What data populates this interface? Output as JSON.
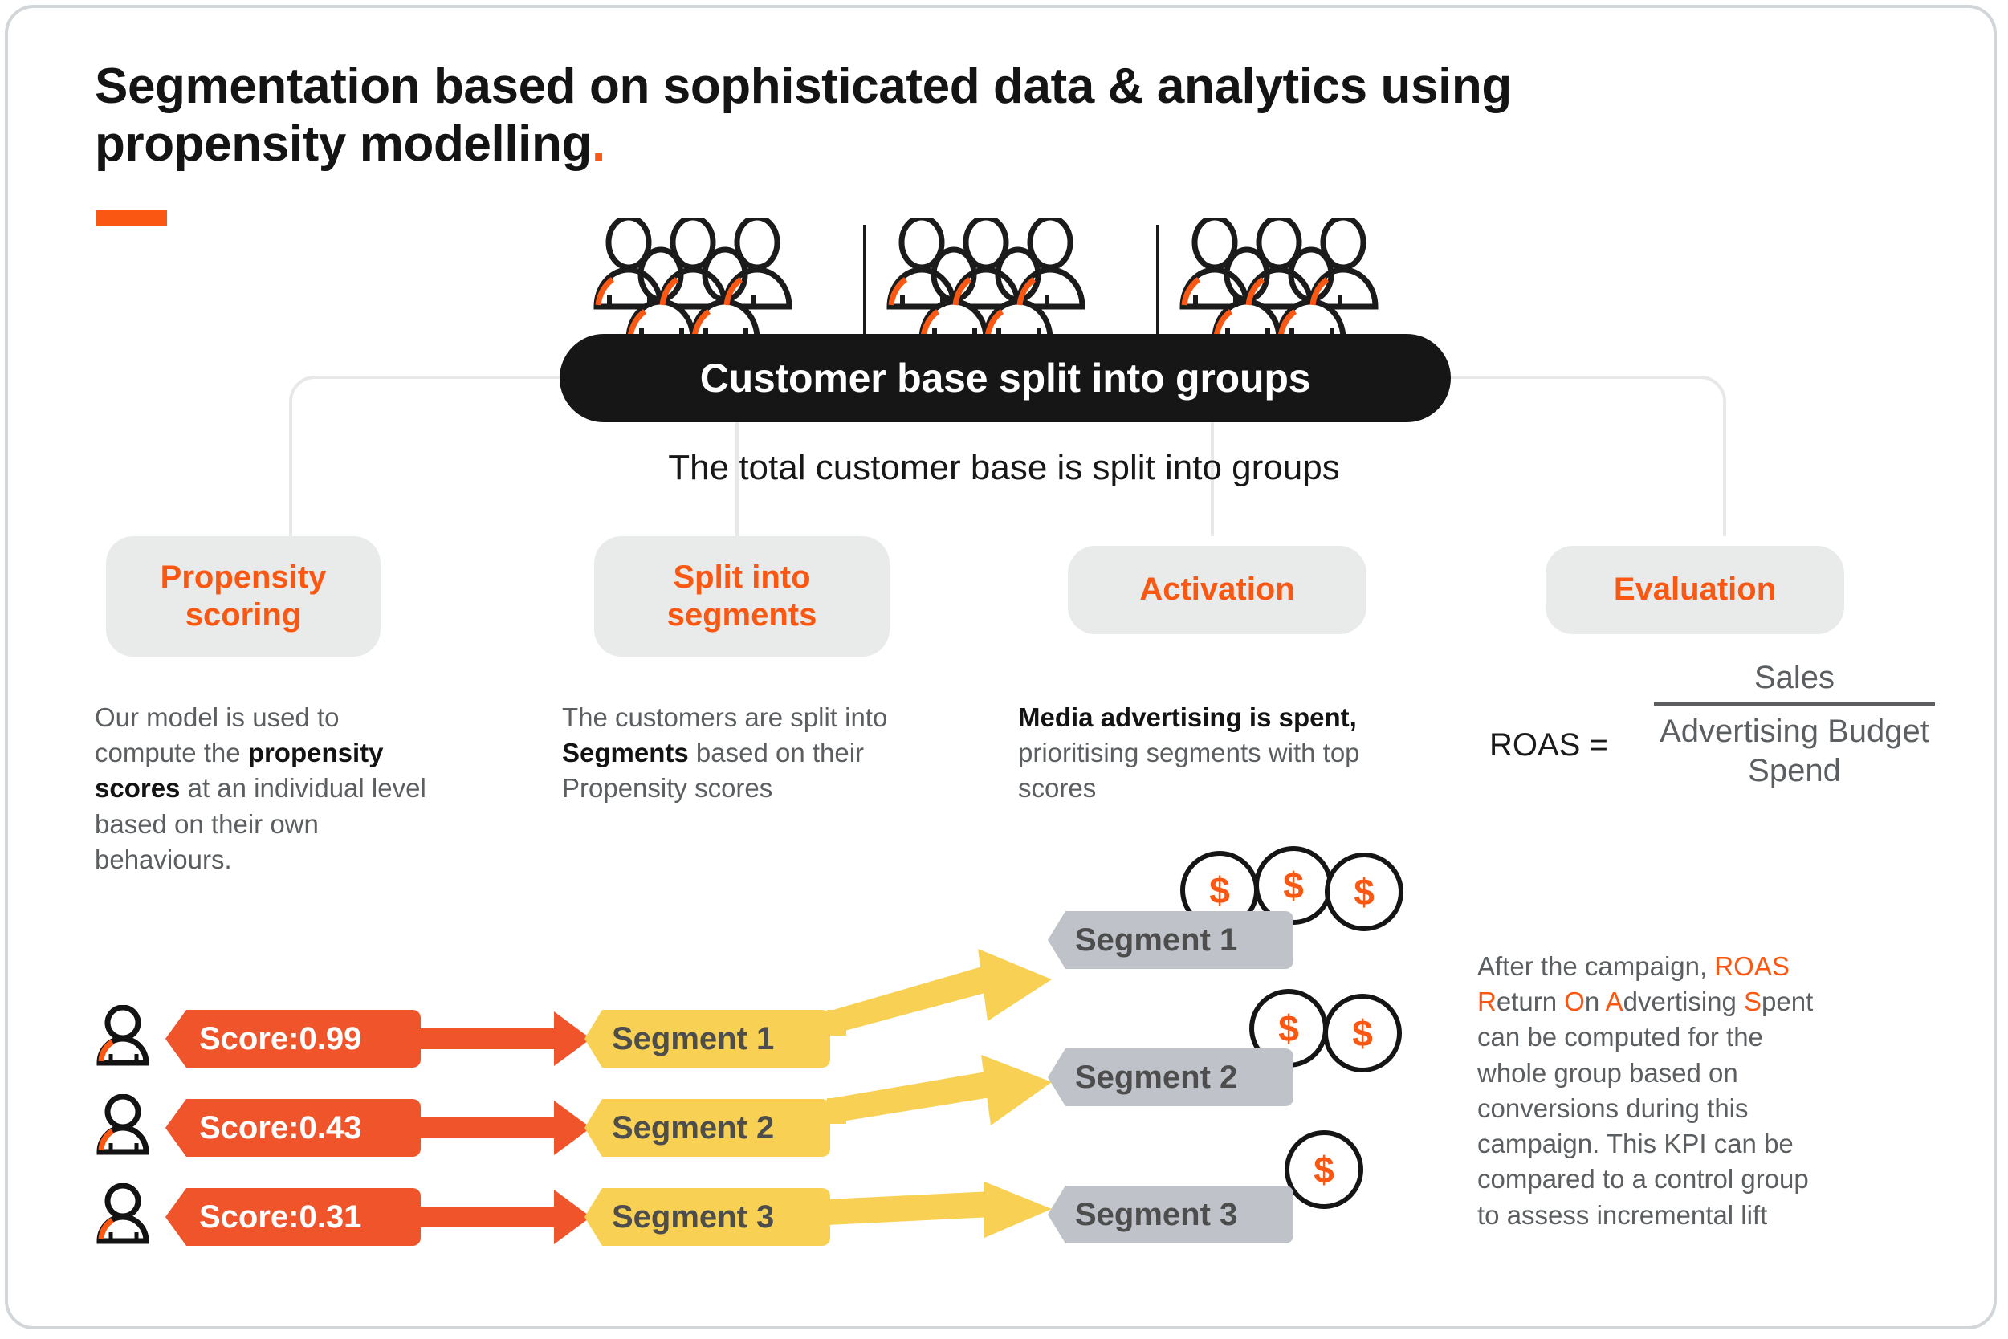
{
  "title": {
    "line1": "Segmentation based on sophisticated data & analytics using",
    "line2": "propensity modelling",
    "period": "."
  },
  "hero": {
    "pill_label": "Customer base split into groups",
    "subtitle": "The total customer base is split into groups",
    "group_count": 3,
    "people_per_group": 6
  },
  "stages": [
    {
      "label": "Propensity scoring",
      "label_line1": "Propensity",
      "label_line2": "scoring"
    },
    {
      "label": "Split into segments",
      "label_line1": "Split into",
      "label_line2": "segments"
    },
    {
      "label": "Activation",
      "label_line1": "Activation",
      "label_line2": ""
    },
    {
      "label": "Evaluation",
      "label_line1": "Evaluation",
      "label_line2": ""
    }
  ],
  "columns": {
    "propensity": {
      "text_a": "Our model is used to compute the ",
      "text_bold": "propensity scores",
      "text_b": " at an individual level based on their own behaviours."
    },
    "split": {
      "text_a": "The customers are split into ",
      "text_bold": "Segments",
      "text_b": " based on their Propensity scores"
    },
    "activation": {
      "text_bold": "Media advertising is spent,",
      "text_b": " prioritising segments with top scores"
    },
    "evaluation": {
      "formula_lhs": "ROAS =",
      "formula_numerator": "Sales",
      "formula_denominator": "Advertising Budget Spend",
      "para_1": "After the campaign, ",
      "acronym": "ROAS",
      "para_2": " ",
      "r": "R",
      "r_rest": "eturn ",
      "o": "O",
      "o_rest": "n ",
      "a": "A",
      "a_rest": "dvertising ",
      "s": "S",
      "s_rest": "pent can be computed for the whole group based on conversions during this campaign. This KPI can be compared to a control group to assess incremental lift"
    }
  },
  "flow": {
    "scores": [
      {
        "label": "Score:0.99"
      },
      {
        "label": "Score:0.43"
      },
      {
        "label": "Score:0.31"
      }
    ],
    "segments_yellow": [
      {
        "label": "Segment 1"
      },
      {
        "label": "Segment 2"
      },
      {
        "label": "Segment 3"
      }
    ],
    "segments_grey": [
      {
        "label": "Segment 1",
        "dollars": 3
      },
      {
        "label": "Segment 2",
        "dollars": 2
      },
      {
        "label": "Segment 3",
        "dollars": 1
      }
    ],
    "dollar_symbol": "$"
  },
  "colors": {
    "orange": "#FA5712",
    "orange_arrow": "#F0542B",
    "yellow": "#F8D154",
    "grey_badge": "#BFC3C9",
    "chip_bg": "#e9eaea",
    "dark": "#161616",
    "body_text": "#5c5f61",
    "connector": "#e8e8e8",
    "frame_border": "#d2d6d9"
  }
}
